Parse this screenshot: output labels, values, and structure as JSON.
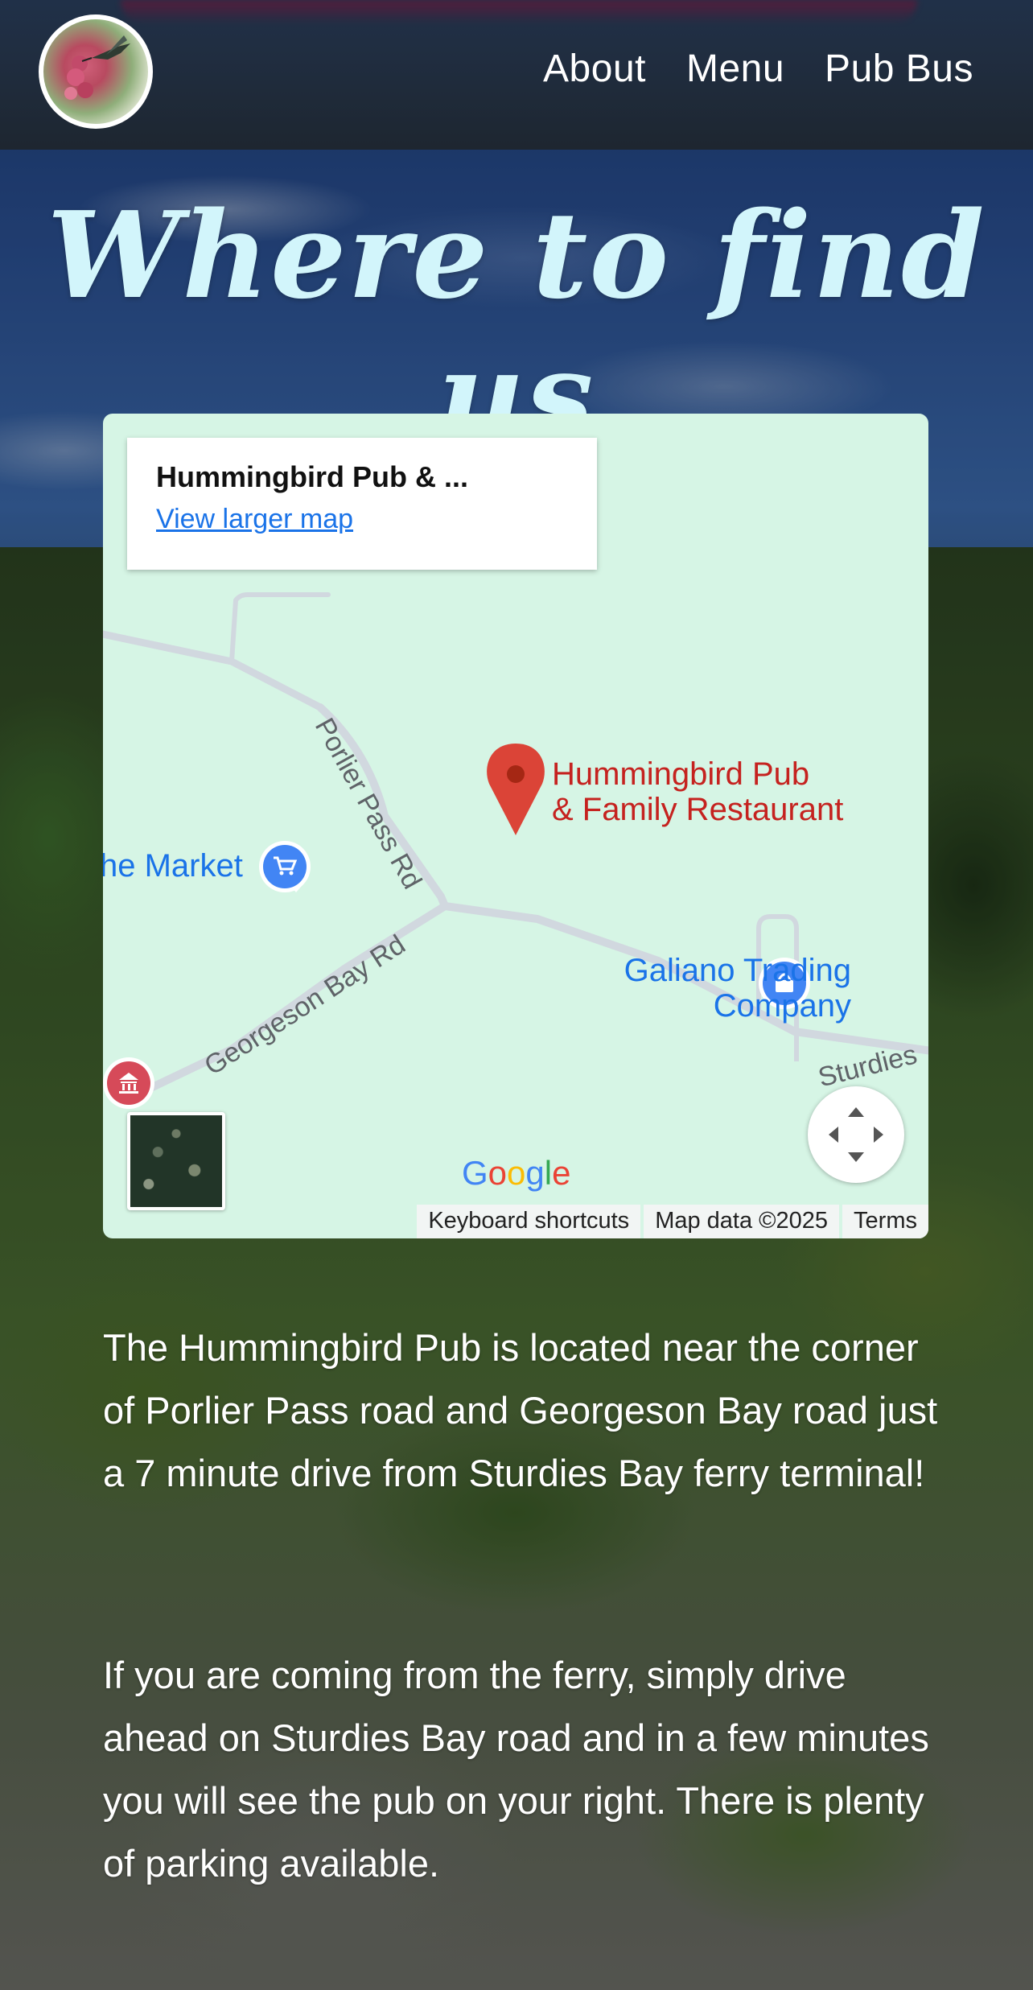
{
  "header": {
    "logo_icon": "hummingbird-logo-icon",
    "nav": [
      {
        "label": "About"
      },
      {
        "label": "Menu"
      },
      {
        "label": "Pub Bus"
      }
    ]
  },
  "page": {
    "title": "Where to find us"
  },
  "map": {
    "place_card": {
      "name": "Hummingbird Pub & ...",
      "link": "View larger map"
    },
    "pois": {
      "main_line1": "Hummingbird Pub",
      "main_line2": "& Family Restaurant",
      "market": "he Market",
      "galiano_line1": "Galiano Trading",
      "galiano_line2": "Company"
    },
    "roads": {
      "porlier": "Porlier Pass Rd",
      "georgeson": "Georgeson Bay Rd",
      "sturdies": "Sturdies"
    },
    "google_logo": "Google",
    "attribution": {
      "shortcuts": "Keyboard shortcuts",
      "data": "Map data ©2025",
      "terms": "Terms"
    },
    "colors": {
      "land": "#d6f5e5",
      "pin": "#db4437",
      "poi_blue": "#1a73e8",
      "poi_red": "#c5221f"
    }
  },
  "content": {
    "paragraph1": "The Hummingbird Pub is located near the corner of Porlier Pass road and Georgeson Bay road just a 7 minute drive from Sturdies Bay ferry terminal!",
    "paragraph2": "If you are coming from the ferry, simply drive ahead on Sturdies Bay road and in a few minutes you will see the pub on your right. There is plenty of parking available."
  },
  "colors": {
    "title": "#d2f5fb",
    "text": "#ffffff"
  }
}
